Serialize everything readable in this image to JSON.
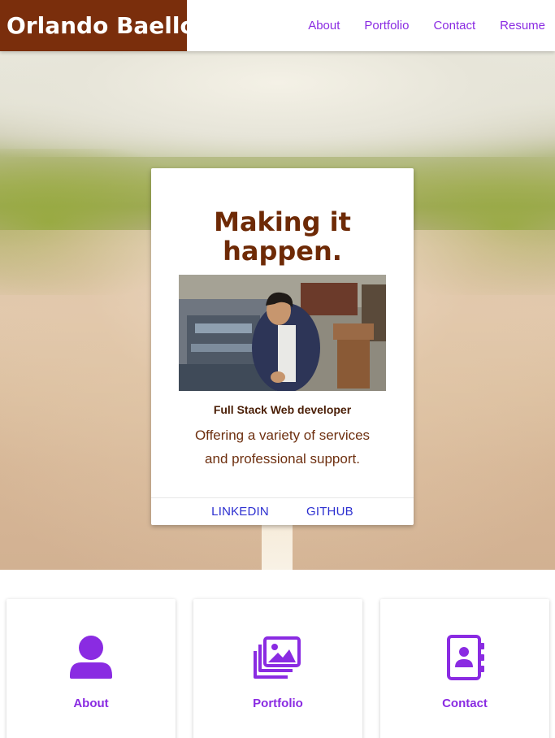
{
  "nav": {
    "brand": "Orlando Baello",
    "links": [
      "About",
      "Portfolio",
      "Contact",
      "Resume"
    ]
  },
  "hero_card": {
    "title_line1": "Making it",
    "title_line2": "happen.",
    "subtitle": "Full Stack Web developer",
    "description_line1": "Offering a variety of services",
    "description_line2": "and professional support.",
    "actions": [
      "LINKEDIN",
      "GITHUB"
    ]
  },
  "features": [
    {
      "label": "About",
      "icon": "user-icon"
    },
    {
      "label": "Portfolio",
      "icon": "images-icon"
    },
    {
      "label": "Contact",
      "icon": "address-book-icon"
    }
  ],
  "colors": {
    "brand_bg": "#7a2e0c",
    "accent": "#8a2be2",
    "title": "#6e2a06",
    "link": "#2b2ed0"
  }
}
